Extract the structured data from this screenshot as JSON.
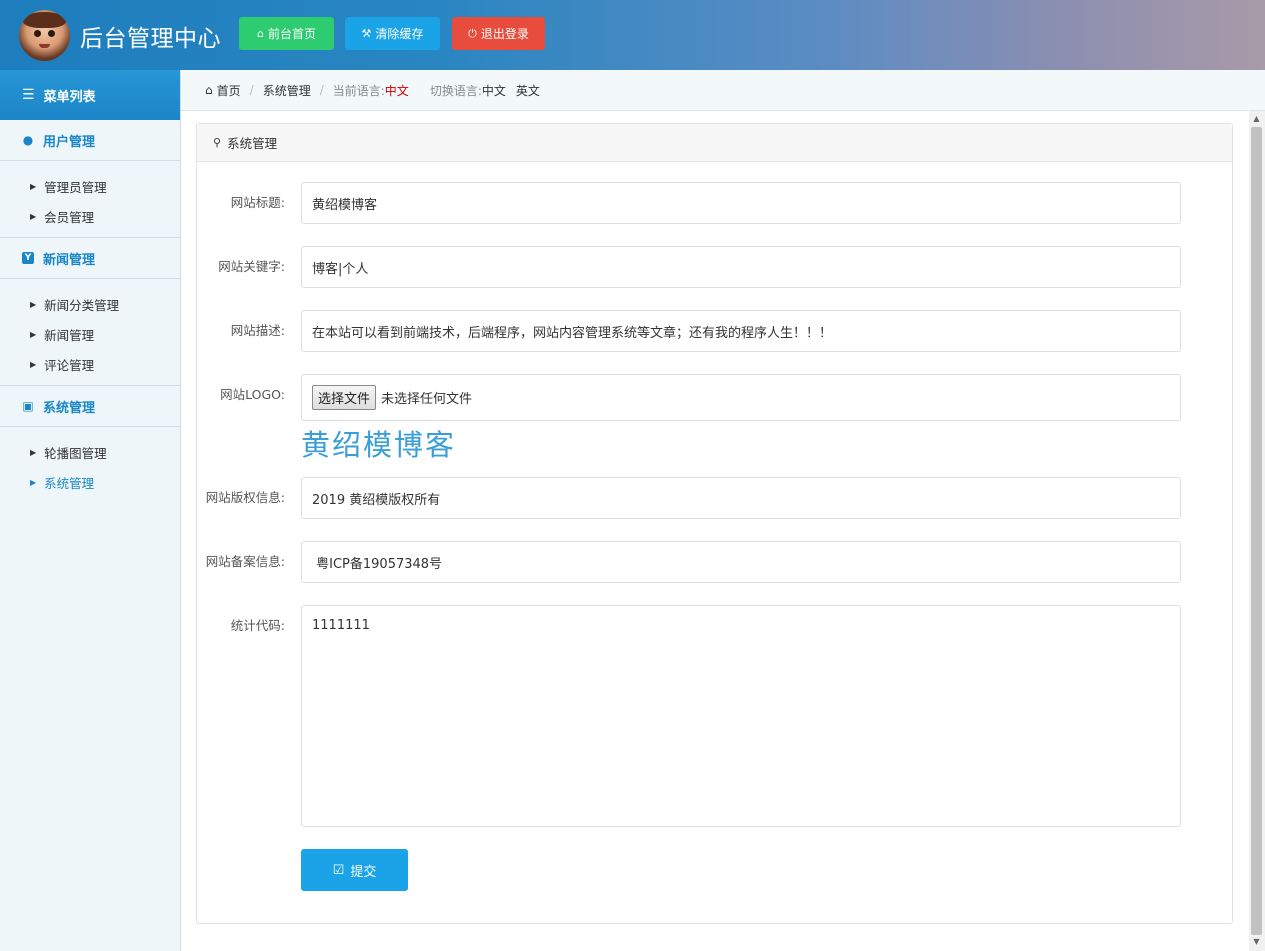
{
  "header": {
    "title": "后台管理中心",
    "buttons": {
      "frontend": "前台首页",
      "clear_cache": "清除缓存",
      "logout": "退出登录"
    },
    "colors": {
      "green": "#2ecc71",
      "blue": "#1aa3e6",
      "red": "#e74c3c"
    }
  },
  "sidebar": {
    "heading": "菜单列表",
    "groups": [
      {
        "title": "用户管理",
        "icon": "user-icon",
        "items": [
          "管理员管理",
          "会员管理"
        ]
      },
      {
        "title": "新闻管理",
        "icon": "y-badge-icon",
        "items": [
          "新闻分类管理",
          "新闻管理",
          "评论管理"
        ]
      },
      {
        "title": "系统管理",
        "icon": "hdd-icon",
        "items": [
          "轮播图管理",
          "系统管理"
        ]
      }
    ],
    "active_item": "系统管理"
  },
  "breadcrumb": {
    "home": "首页",
    "current": "系统管理",
    "current_lang_label": "当前语言:",
    "current_lang_value": "中文",
    "switch_label": "切换语言:",
    "lang_zh": "中文",
    "lang_en": "英文"
  },
  "panel": {
    "title": "系统管理",
    "fields": {
      "site_title": {
        "label": "网站标题:",
        "value": "黄绍模博客"
      },
      "keywords": {
        "label": "网站关键字:",
        "value": "博客|个人"
      },
      "description": {
        "label": "网站描述:",
        "value": "在本站可以看到前端技术，后端程序，网站内容管理系统等文章；还有我的程序人生！！！"
      },
      "logo": {
        "label": "网站LOGO:",
        "button": "选择文件",
        "status": "未选择任何文件",
        "preview_text": "黄绍模博客"
      },
      "copyright": {
        "label": "网站版权信息:",
        "value": "2019 黄绍模版权所有"
      },
      "icp": {
        "label": "网站备案信息:",
        "value": " 粤ICP备19057348号"
      },
      "stats_code": {
        "label": "统计代码:",
        "value": "1111111"
      }
    },
    "submit": "提交"
  }
}
